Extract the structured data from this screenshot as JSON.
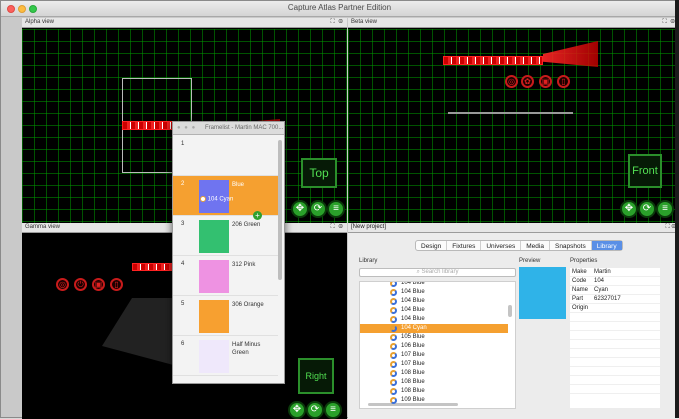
{
  "window": {
    "title": "Capture Atlas Partner Edition"
  },
  "panes": {
    "alpha": {
      "label": "Alpha view",
      "ctrls": "⛶ ⊗",
      "tag": "Top"
    },
    "beta": {
      "label": "Beta view",
      "ctrls": "⛶ ⊗",
      "tag": "Front"
    },
    "gamma": {
      "label": "Gamma view",
      "ctrls": "⛶ ⊗",
      "tag": "Right"
    }
  },
  "framelist": {
    "title": "Framelist - Martin MAC 700...",
    "drag_label": "104 Cyan",
    "rows": [
      {
        "num": "1",
        "name": "",
        "color": "#f3f3f3"
      },
      {
        "num": "2",
        "name": "Blue",
        "color": "#6f74f0"
      },
      {
        "num": "3",
        "name": "206 Green",
        "color": "#33c070"
      },
      {
        "num": "4",
        "name": "312 Pink",
        "color": "#ee92e2"
      },
      {
        "num": "5",
        "name": "306 Orange",
        "color": "#f7a030"
      },
      {
        "num": "6",
        "name": "Half Minus Green",
        "color": "#efe8fb"
      }
    ]
  },
  "project": {
    "label": "[New project]",
    "ctrls": "⛶ ⊗",
    "tabs": [
      "Design",
      "Fixtures",
      "Universes",
      "Media",
      "Snapshots",
      "Library"
    ],
    "active_tab": "Library",
    "library_label": "Library",
    "preview_label": "Preview",
    "properties_label": "Properties",
    "search_placeholder": "Search library",
    "library_items": [
      "104 Blue",
      "104 Blue",
      "104 Blue",
      "104 Blue",
      "104 Blue",
      "104 Cyan",
      "105 Blue",
      "106 Blue",
      "107 Blue",
      "107 Blue",
      "108 Blue",
      "108 Blue",
      "108 Blue",
      "109 Blue"
    ],
    "selected_index": 5,
    "preview_color": "#2fb3e8",
    "properties": [
      {
        "k": "Make",
        "v": "Martin"
      },
      {
        "k": "Code",
        "v": "104"
      },
      {
        "k": "Name",
        "v": "Cyan"
      },
      {
        "k": "Part",
        "v": "62327017"
      },
      {
        "k": "Origin",
        "v": ""
      }
    ]
  },
  "icons": {
    "nav": "move-icon",
    "orbit": "orbit-icon",
    "menu": "menu-icon"
  }
}
